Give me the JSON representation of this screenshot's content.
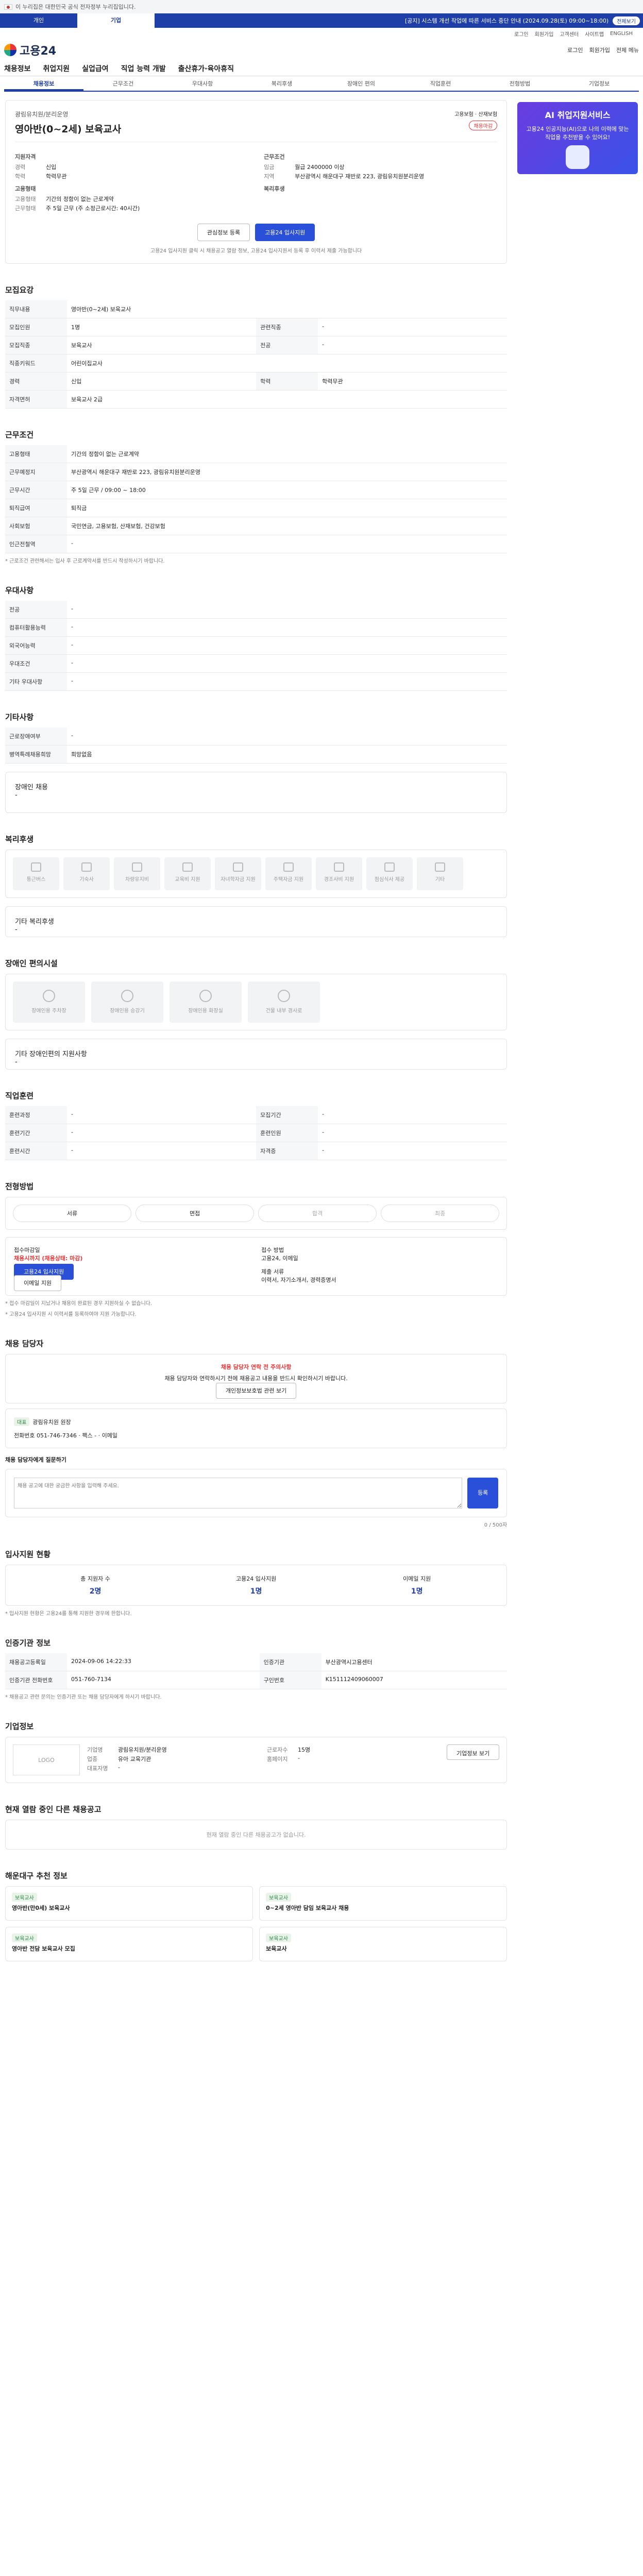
{
  "gov": {
    "notice": "이 누리집은 대한민국 공식 전자정부 누리집입니다."
  },
  "topbar": {
    "tabs": [
      "개인",
      "기업"
    ],
    "notice": "[공지] 시스템 개선 작업에 따른 서비스 중단 안내 (2024.09.28(토) 09:00~18:00)",
    "notice_btn": "전체보기"
  },
  "util": [
    "로그인",
    "회원가입",
    "고객센터",
    "사이트맵",
    "ENGLISH"
  ],
  "header": {
    "logo": "고용24",
    "actions": [
      "로그인",
      "회원가입",
      "전체 메뉴"
    ]
  },
  "gnb": [
    "채용정보",
    "취업지원",
    "실업급여",
    "직업 능력 개발",
    "출산휴가·육아휴직"
  ],
  "subtabs": [
    "채용정보",
    "근무조건",
    "우대사항",
    "복리후생",
    "장애인 편의",
    "직업훈련",
    "전형방법",
    "기업정보"
  ],
  "job": {
    "company": "광림유치원/분리운영",
    "title": "영아반(0~2세) 보육교사",
    "badge": "채용마감",
    "badge2": "고용보험 · 산재보험",
    "career_label": "지원자격",
    "career": "경력",
    "career_v": "신입",
    "edu": "학력",
    "edu_v": "학력무관",
    "cond_label": "근무조건",
    "pay": "임금",
    "pay_v": "월급 2400000 이상",
    "loc": "지역",
    "loc_v": "부산광역시 해운대구 재반로 223, 광림유치원분리운영",
    "emp_label": "고용형태",
    "emp": "고용형태",
    "emp_v": "기간의 정함이 없는 근로계약",
    "time": "근무형태",
    "time_v": "주 5일 근무 (주 소정근로시간: 40시간)",
    "welfare_label": "복리후생",
    "btn_save": "관심정보 등록",
    "btn_apply": "고용24 입사지원",
    "sub_note": "고용24 입사지원 클릭 시 채용공고 열람 정보, 고용24 입사지원서 등록 후 이력서 제출 가능합니다"
  },
  "side": {
    "title": "AI 취업지원서비스",
    "text": "고용24 인공지능(AI)으로 나의 이력에 맞는 직업을 추천받을 수 있어요!"
  },
  "s1": {
    "title": "모집요강",
    "rows": [
      [
        "직무내용",
        "영아반(0~2세) 보육교사"
      ],
      [
        "모집인원",
        "1명"
      ],
      [
        "모집직종",
        "보육교사"
      ],
      [
        "직종키워드",
        "어린이집교사"
      ],
      [
        "경력",
        "신입"
      ],
      [
        "자격면허",
        "보육교사 2급"
      ]
    ],
    "rows2": [
      [
        "관련직종",
        "-"
      ],
      [
        "전공",
        "-"
      ],
      [
        "학력",
        "학력무관"
      ]
    ]
  },
  "s2": {
    "title": "근무조건",
    "rows": [
      [
        "고용형태",
        "기간의 정함이 없는 근로계약"
      ],
      [
        "근무예정지",
        "부산광역시 해운대구 재반로 223, 광림유치원분리운영"
      ],
      [
        "근무시간",
        "주 5일 근무 / 09:00 ~ 18:00"
      ],
      [
        "퇴직급여",
        "퇴직금"
      ],
      [
        "사회보험",
        "국민연금, 고용보험, 산재보험, 건강보험"
      ],
      [
        "인근전철역",
        "-"
      ]
    ],
    "note": "* 근로조건 관련해서는 입사 후 근로계약서를 반드시 작성하시기 바랍니다."
  },
  "s3": {
    "title": "우대사항",
    "rows": [
      [
        "전공",
        "-"
      ],
      [
        "컴퓨터활용능력",
        "-"
      ],
      [
        "외국어능력",
        "-"
      ],
      [
        "우대조건",
        "-"
      ],
      [
        "기타 우대사항",
        "-"
      ]
    ]
  },
  "s4": {
    "title": "기타사항",
    "rows": [
      [
        "근로장애여부",
        "-"
      ],
      [
        "병역특례채용희망",
        "희망없음"
      ]
    ],
    "extra": "장애인 채용",
    "extra_v": "-"
  },
  "s5": {
    "title": "복리후생",
    "items": [
      "통근버스",
      "기숙사",
      "차량유지비",
      "교육비 지원",
      "자녀학자금 지원",
      "주택자금 지원",
      "경조사비 지원",
      "점심식사 제공",
      "기타"
    ],
    "etc_label": "기타 복리후생",
    "etc": "-"
  },
  "s6": {
    "title": "장애인 편의시설",
    "items": [
      "장애인용 주차장",
      "장애인용 승강기",
      "장애인용 화장실",
      "건물 내부 경사로"
    ],
    "etc_label": "기타 장애인편의 지원사항",
    "etc": "-"
  },
  "s7": {
    "title": "직업훈련",
    "rows": [
      [
        "훈련과정",
        "-"
      ],
      [
        "모집기간",
        "-"
      ],
      [
        "훈련기간",
        "-"
      ],
      [
        "훈련인원",
        "-"
      ],
      [
        "훈련시간",
        "-"
      ],
      [
        "자격증",
        "-"
      ]
    ]
  },
  "s8": {
    "title": "전형방법",
    "steps": [
      "서류",
      "면접",
      "합격",
      "최종"
    ],
    "apply_label": "접수마감일",
    "apply_date": "채용시까지 (채용상태: 마감)",
    "apply_btn": "고용24 입사지원",
    "apply_btn2": "이메일 지원",
    "docs_label": "접수 방법",
    "docs": "고용24, 이메일",
    "docs2_label": "제출 서류",
    "docs2": "이력서, 자기소개서, 경력증명서",
    "notes": [
      "* 접수 마감일이 지났거나 채용이 완료된 경우 지원하실 수 없습니다.",
      "* 고용24 입사지원 시 이력서를 등록하여야 지원 가능합니다."
    ]
  },
  "s9": {
    "title": "채용 담당자",
    "warn_title": "채용 담당자 연락 전 주의사항",
    "warn_text": "채용 담당자와 연락하시기 전에 채용공고 내용을 반드시 확인하시기 바랍니다.",
    "warn_btn": "개인정보보호법 관련 보기",
    "tag": "대표",
    "mgr": "광림유치원 원장",
    "phone_l": "전화번호",
    "phone": "051-746-7346",
    "fax_l": "팩스",
    "fax": "-",
    "email_l": "이메일",
    "inq_label": "채용 담당자에게 질문하기",
    "inq_ph": "채용 공고에 대한 궁금한 사항을 입력해 주세요.",
    "inq_btn": "등록",
    "inq_count": "0 / 500자"
  },
  "s10": {
    "title": "입사지원 현황",
    "stats": [
      [
        "총 지원자 수",
        "2명"
      ],
      [
        "고용24 입사지원",
        "1명"
      ],
      [
        "이메일 지원",
        "1명"
      ]
    ],
    "note": "* 입사지원 현황은 고용24를 통해 지원한 경우에 한합니다."
  },
  "s11": {
    "title": "인증기관 정보",
    "rows": [
      [
        "채용공고등록일",
        "2024-09-06 14:22:33",
        "인증기관",
        "부산광역시고용센터"
      ],
      [
        "인증기관 전화번호",
        "051-760-7134",
        "구인번호",
        "K151112409060007"
      ]
    ],
    "note": "* 채용공고 관련 문의는 인증기관 또는 채용 담당자에게 하시기 바랍니다."
  },
  "s12": {
    "title": "기업정보",
    "logo": "LOGO",
    "rows": [
      [
        "기업명",
        "광림유치원/분리운영"
      ],
      [
        "업종",
        "유아 교육기관"
      ],
      [
        "대표자명",
        "-"
      ],
      [
        "근로자수",
        "15명"
      ],
      [
        "홈페이지",
        "-"
      ]
    ],
    "btn": "기업정보 보기"
  },
  "s13": {
    "title": "현재 열람 중인 다른 채용공고",
    "empty": "현재 열람 중인 다른 채용공고가 없습니다."
  },
  "s14": {
    "title": "해운대구 추천 정보",
    "recs": [
      [
        "보육교사",
        "영아반(만0세) 보육교사"
      ],
      [
        "보육교사",
        "0~2세 영아반 담임 보육교사 채용"
      ],
      [
        "보육교사",
        "영아반 전담 보육교사 모집"
      ],
      [
        "보육교사",
        "보육교사"
      ]
    ]
  }
}
